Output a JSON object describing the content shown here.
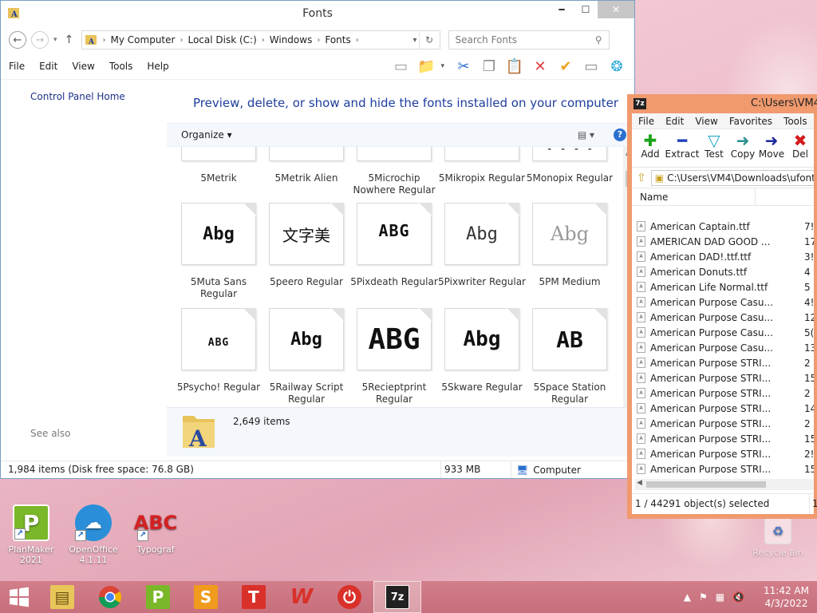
{
  "explorer": {
    "title": "Fonts",
    "breadcrumb": [
      "My Computer",
      "Local Disk (C:)",
      "Windows",
      "Fonts"
    ],
    "search_placeholder": "Search Fonts",
    "menu": [
      "File",
      "Edit",
      "View",
      "Tools",
      "Help"
    ],
    "left_pane": {
      "home_link": "Control Panel Home",
      "see_also": "See also"
    },
    "heading": "Preview, delete, or show and hide the fonts installed on your computer",
    "organize": "Organize",
    "top_row": [
      {
        "name": "5Metrik"
      },
      {
        "name": "5Metrik Alien"
      },
      {
        "name": "5Microchip Nowhere Regular"
      },
      {
        "name": "5Mikropix Regular"
      },
      {
        "name": "5Monopix Regular"
      }
    ],
    "row2": [
      {
        "name": "5Muta Sans Regular",
        "sample": "Abg"
      },
      {
        "name": "5peero Regular",
        "sample": "文字美"
      },
      {
        "name": "5Pixdeath Regular",
        "sample": "ABG"
      },
      {
        "name": "5Pixwriter Regular",
        "sample": "Abg"
      },
      {
        "name": "5PM Medium",
        "sample": "Abg"
      }
    ],
    "row3": [
      {
        "name": "5Psycho! Regular",
        "sample": "ABG"
      },
      {
        "name": "5Railway Script Regular",
        "sample": "Abg"
      },
      {
        "name": "5Recieptprint Regular",
        "sample": "ABG"
      },
      {
        "name": "5Skware Regular",
        "sample": "Abg"
      },
      {
        "name": "5Space Station Regular",
        "sample": "AB"
      }
    ],
    "details_count": "2,649 items",
    "status": {
      "items": "1,984 items (Disk free space: 76.8 GB)",
      "size": "933 MB",
      "location": "Computer"
    }
  },
  "zip": {
    "title": "C:\\Users\\VM4",
    "menu": [
      "File",
      "Edit",
      "View",
      "Favorites",
      "Tools",
      "He"
    ],
    "toolbar": [
      {
        "label": "Add",
        "glyph": "✚",
        "color": "#1aa31a"
      },
      {
        "label": "Extract",
        "glyph": "━",
        "color": "#1f3fbf"
      },
      {
        "label": "Test",
        "glyph": "▼",
        "color": "#22a7c9"
      },
      {
        "label": "Copy",
        "glyph": "➜",
        "color": "#2a8f8f"
      },
      {
        "label": "Move",
        "glyph": "➜",
        "color": "#1b2a9a"
      },
      {
        "label": "Del",
        "glyph": "✖",
        "color": "#d21a1a"
      }
    ],
    "path": "C:\\Users\\VM4\\Downloads\\ufont.",
    "col_name": "Name",
    "files": [
      {
        "name": "American Captain.ttf",
        "size": "7!"
      },
      {
        "name": "AMERICAN DAD GOOD ...",
        "size": "17!"
      },
      {
        "name": "American DAD!.ttf.ttf",
        "size": "3!"
      },
      {
        "name": "American Donuts.ttf",
        "size": "4"
      },
      {
        "name": "American Life Normal.ttf",
        "size": "5"
      },
      {
        "name": "American Purpose Casu...",
        "size": "4!"
      },
      {
        "name": "American Purpose Casu...",
        "size": "12!"
      },
      {
        "name": "American Purpose Casu...",
        "size": "5("
      },
      {
        "name": "American Purpose Casu...",
        "size": "13"
      },
      {
        "name": "American Purpose STRI...",
        "size": "2"
      },
      {
        "name": "American Purpose STRI...",
        "size": "15"
      },
      {
        "name": "American Purpose STRI...",
        "size": "2"
      },
      {
        "name": "American Purpose STRI...",
        "size": "14"
      },
      {
        "name": "American Purpose STRI...",
        "size": "2"
      },
      {
        "name": "American Purpose STRI...",
        "size": "15("
      },
      {
        "name": "American Purpose STRI...",
        "size": "2!"
      },
      {
        "name": "American Purpose STRI...",
        "size": "15!"
      }
    ],
    "status": "1 / 44291 object(s) selected",
    "status_right": "1"
  },
  "desktop": {
    "icons": [
      {
        "label": "PlanMaker 2021"
      },
      {
        "label": "OpenOffice 4.1.11"
      },
      {
        "label": "Typograf"
      }
    ],
    "recycle_bin": "Recycle Bin"
  },
  "taskbar": {
    "time": "11:42 AM",
    "date": "4/3/2022"
  }
}
